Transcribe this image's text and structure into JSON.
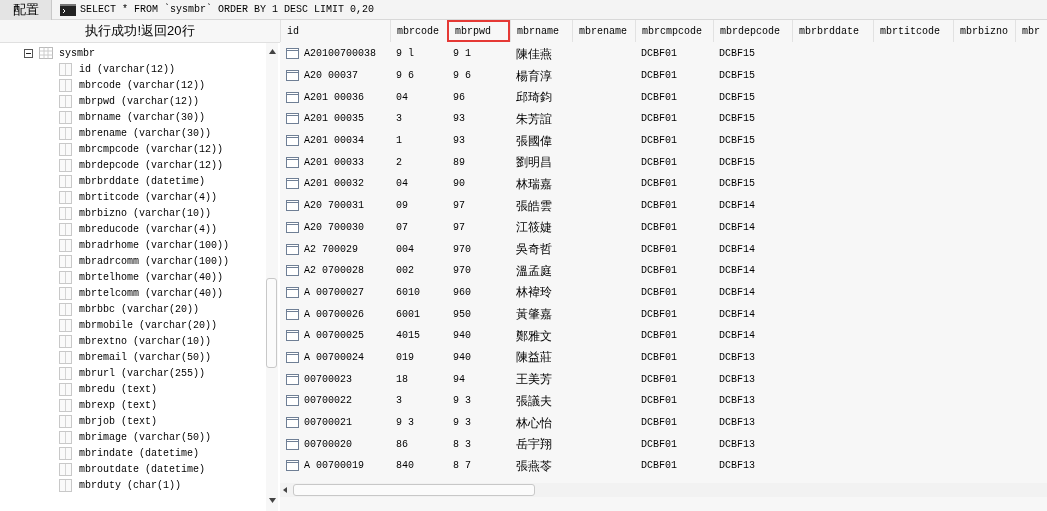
{
  "toolbar": {
    "config_button": "配置",
    "query": "SELECT * FROM `sysmbr` ORDER BY 1 DESC LIMIT 0,20"
  },
  "status": "执行成功!返回20行",
  "tree": {
    "label": "sysmbr",
    "expanded": true,
    "children": [
      {
        "label": "id (varchar(12))"
      },
      {
        "label": "mbrcode (varchar(12))"
      },
      {
        "label": "mbrpwd (varchar(12))"
      },
      {
        "label": "mbrname (varchar(30))"
      },
      {
        "label": "mbrename (varchar(30))"
      },
      {
        "label": "mbrcmpcode (varchar(12))"
      },
      {
        "label": "mbrdepcode (varchar(12))"
      },
      {
        "label": "mbrbrddate (datetime)"
      },
      {
        "label": "mbrtitcode (varchar(4))"
      },
      {
        "label": "mbrbizno (varchar(10))"
      },
      {
        "label": "mbreducode (varchar(4))"
      },
      {
        "label": "mbradrhome (varchar(100))"
      },
      {
        "label": "mbradrcomm (varchar(100))"
      },
      {
        "label": "mbrtelhome (varchar(40))"
      },
      {
        "label": "mbrtelcomm (varchar(40))"
      },
      {
        "label": "mbrbbc (varchar(20))"
      },
      {
        "label": "mbrmobile (varchar(20))"
      },
      {
        "label": "mbrextno (varchar(10))"
      },
      {
        "label": "mbremail (varchar(50))"
      },
      {
        "label": "mbrurl (varchar(255))"
      },
      {
        "label": "mbredu (text)"
      },
      {
        "label": "mbrexp (text)"
      },
      {
        "label": "mbrjob (text)"
      },
      {
        "label": "mbrimage (varchar(50))"
      },
      {
        "label": "mbrindate (datetime)"
      },
      {
        "label": "mbroutdate (datetime)"
      },
      {
        "label": "mbrduty (char(1))"
      }
    ]
  },
  "table": {
    "columns": [
      {
        "label": "id",
        "highlighted": false
      },
      {
        "label": "mbrcode",
        "highlighted": false
      },
      {
        "label": "mbrpwd",
        "highlighted": true
      },
      {
        "label": "mbrname",
        "highlighted": false
      },
      {
        "label": "mbrename",
        "highlighted": false
      },
      {
        "label": "mbrcmpcode",
        "highlighted": false
      },
      {
        "label": "mbrdepcode",
        "highlighted": false
      },
      {
        "label": "mbrbrddate",
        "highlighted": false
      },
      {
        "label": "mbrtitcode",
        "highlighted": false
      },
      {
        "label": "mbrbizno",
        "highlighted": false
      },
      {
        "label": "mbr",
        "highlighted": false
      }
    ],
    "rows": [
      {
        "id": "A20100700038",
        "mbrcode": "9 l",
        "mbrpwd": "9 1",
        "mbrname": "陳佳燕",
        "mbrcmpcode": "DCBF01",
        "mbrdepcode": "DCBF15"
      },
      {
        "id": "A20 00037",
        "mbrcode": "9 6",
        "mbrpwd": "9 6",
        "mbrname": "楊育淳",
        "mbrcmpcode": "DCBF01",
        "mbrdepcode": "DCBF15"
      },
      {
        "id": "A201 00036",
        "mbrcode": "04",
        "mbrpwd": "96",
        "mbrname": "邱琦鈞",
        "mbrcmpcode": "DCBF01",
        "mbrdepcode": "DCBF15"
      },
      {
        "id": "A201 00035",
        "mbrcode": "3",
        "mbrpwd": "93",
        "mbrname": "朱芳誼",
        "mbrcmpcode": "DCBF01",
        "mbrdepcode": "DCBF15"
      },
      {
        "id": "A201 00034",
        "mbrcode": "1",
        "mbrpwd": "93",
        "mbrname": "張國偉",
        "mbrcmpcode": "DCBF01",
        "mbrdepcode": "DCBF15"
      },
      {
        "id": "A201 00033",
        "mbrcode": "2",
        "mbrpwd": "89",
        "mbrname": "劉明昌",
        "mbrcmpcode": "DCBF01",
        "mbrdepcode": "DCBF15"
      },
      {
        "id": "A201 00032",
        "mbrcode": "04",
        "mbrpwd": "90",
        "mbrname": "林瑞嘉",
        "mbrcmpcode": "DCBF01",
        "mbrdepcode": "DCBF15"
      },
      {
        "id": "A20 700031",
        "mbrcode": "09",
        "mbrpwd": "97",
        "mbrname": "張皓雲",
        "mbrcmpcode": "DCBF01",
        "mbrdepcode": "DCBF14"
      },
      {
        "id": "A20 700030",
        "mbrcode": "07",
        "mbrpwd": "97",
        "mbrname": "江筱婕",
        "mbrcmpcode": "DCBF01",
        "mbrdepcode": "DCBF14"
      },
      {
        "id": "A2 700029",
        "mbrcode": "004",
        "mbrpwd": "970",
        "mbrname": "吳奇哲",
        "mbrcmpcode": "DCBF01",
        "mbrdepcode": "DCBF14"
      },
      {
        "id": "A2 0700028",
        "mbrcode": "002",
        "mbrpwd": "970",
        "mbrname": "溫孟庭",
        "mbrcmpcode": "DCBF01",
        "mbrdepcode": "DCBF14"
      },
      {
        "id": "A 00700027",
        "mbrcode": "6010",
        "mbrpwd": "960",
        "mbrname": "林褘玲",
        "mbrcmpcode": "DCBF01",
        "mbrdepcode": "DCBF14"
      },
      {
        "id": "A 00700026",
        "mbrcode": "6001",
        "mbrpwd": "950",
        "mbrname": "黃肇嘉",
        "mbrcmpcode": "DCBF01",
        "mbrdepcode": "DCBF14"
      },
      {
        "id": "A 00700025",
        "mbrcode": "4015",
        "mbrpwd": "940",
        "mbrname": "鄭雅文",
        "mbrcmpcode": "DCBF01",
        "mbrdepcode": "DCBF14"
      },
      {
        "id": "A 00700024",
        "mbrcode": "019",
        "mbrpwd": "940",
        "mbrname": "陳益莊",
        "mbrcmpcode": "DCBF01",
        "mbrdepcode": "DCBF13"
      },
      {
        "id": "00700023",
        "mbrcode": "18",
        "mbrpwd": "94",
        "mbrname": "王美芳",
        "mbrcmpcode": "DCBF01",
        "mbrdepcode": "DCBF13"
      },
      {
        "id": "00700022",
        "mbrcode": "3",
        "mbrpwd": "9 3",
        "mbrname": "張議夫",
        "mbrcmpcode": "DCBF01",
        "mbrdepcode": "DCBF13"
      },
      {
        "id": "00700021",
        "mbrcode": "9 3",
        "mbrpwd": "9 3",
        "mbrname": "林心怡",
        "mbrcmpcode": "DCBF01",
        "mbrdepcode": "DCBF13"
      },
      {
        "id": "00700020",
        "mbrcode": "86",
        "mbrpwd": "8 3",
        "mbrname": "岳宇翔",
        "mbrcmpcode": "DCBF01",
        "mbrdepcode": "DCBF13"
      },
      {
        "id": "A 00700019",
        "mbrcode": "840",
        "mbrpwd": "8 7",
        "mbrname": "張燕苓",
        "mbrcmpcode": "DCBF01",
        "mbrdepcode": "DCBF13"
      }
    ]
  }
}
